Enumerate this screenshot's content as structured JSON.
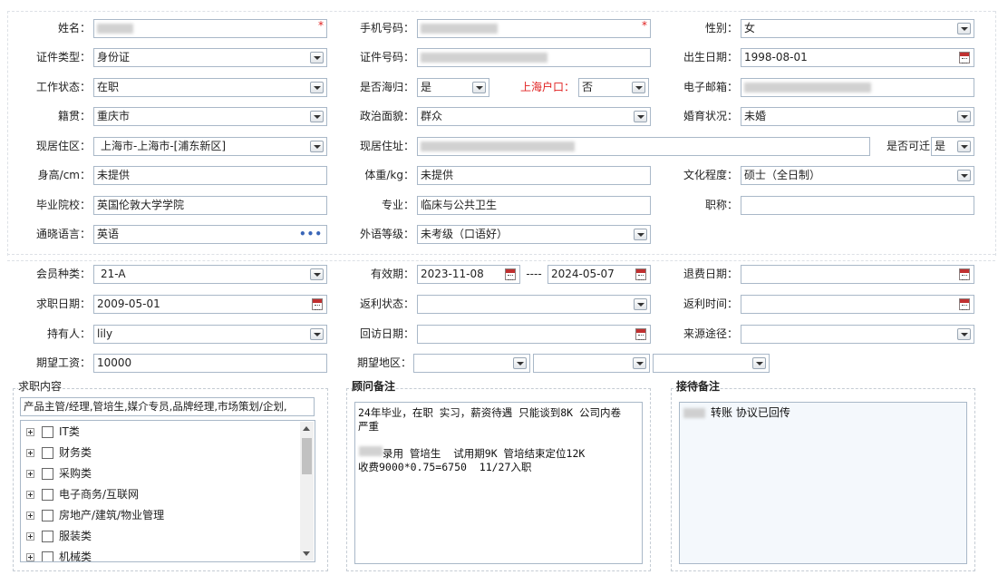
{
  "profile": {
    "name_label": "姓名：",
    "phone_label": "手机号码：",
    "gender_label": "性别：",
    "gender_value": "女",
    "idtype_label": "证件类型：",
    "idtype_value": "身份证",
    "idno_label": "证件号码：",
    "birth_label": "出生日期：",
    "birth_value": "1998-08-01",
    "work_label": "工作状态：",
    "work_value": "在职",
    "returnee_label": "是否海归：",
    "returnee_value": "是",
    "hukou_label": "上海户口：",
    "hukou_value": "否",
    "email_label": "电子邮箱：",
    "native_label": "籍贯：",
    "native_value": "重庆市",
    "political_label": "政治面貌：",
    "political_value": "群众",
    "marital_label": "婚育状况：",
    "marital_value": "未婚",
    "residence_label": "现居住区：",
    "residence_value": "上海市-上海市-[浦东新区]",
    "address_label": "现居住址：",
    "relocate_label": "是否可迁",
    "relocate_value": "是",
    "height_label": "身高/cm：",
    "height_value": "未提供",
    "weight_label": "体重/kg：",
    "weight_value": "未提供",
    "edu_label": "文化程度：",
    "edu_value": "硕士（全日制）",
    "school_label": "毕业院校：",
    "school_value": "英国伦敦大学学院",
    "major_label": "专业：",
    "major_value": "临床与公共卫生",
    "title_label": "职称：",
    "lang_label": "通晓语言：",
    "lang_value": "英语",
    "langlevel_label": "外语等级：",
    "langlevel_value": "未考级（口语好）"
  },
  "member": {
    "type_label": "会员种类：",
    "type_value": "21-A",
    "valid_label": "有效期：",
    "valid_from": "2023-11-08",
    "valid_sep": "----",
    "valid_to": "2024-05-07",
    "refund_date_label": "退费日期：",
    "jobseek_date_label": "求职日期：",
    "jobseek_date_value": "2009-05-01",
    "rebate_status_label": "返利状态：",
    "rebate_time_label": "返利时间：",
    "holder_label": "持有人：",
    "holder_value": "lily",
    "visit_label": "回访日期：",
    "source_label": "来源途径：",
    "salary_label": "期望工资：",
    "salary_value": "10000",
    "region_label": "期望地区："
  },
  "job_panel": {
    "title": "求职内容",
    "summary": "产品主管/经理,管培生,媒介专员,品牌经理,市场策划/企划,",
    "categories": [
      "IT类",
      "财务类",
      "采购类",
      "电子商务/互联网",
      "房地产/建筑/物业管理",
      "服装类",
      "机械类"
    ]
  },
  "advisor_panel": {
    "title": "顾问备注",
    "line1": "24年毕业，在职 实习，薪资待遇 只能谈到8K 公司内卷",
    "line2": "严重",
    "line4": "录用 管培生  试用期9K 管培结束定位12K",
    "line5": "收费9000*0.75=6750  11/27入职"
  },
  "reception_panel": {
    "title": "接待备注",
    "text": "转账 协议已回传"
  },
  "icons": {
    "dropdown": "chevron-down-icon",
    "calendar": "calendar-icon",
    "ellipsis": "more-icon",
    "expand": "expand-plus-icon"
  },
  "colors": {
    "required": "#e02020",
    "field_border": "#a9b8c8",
    "hukou_label": "#e02020"
  }
}
